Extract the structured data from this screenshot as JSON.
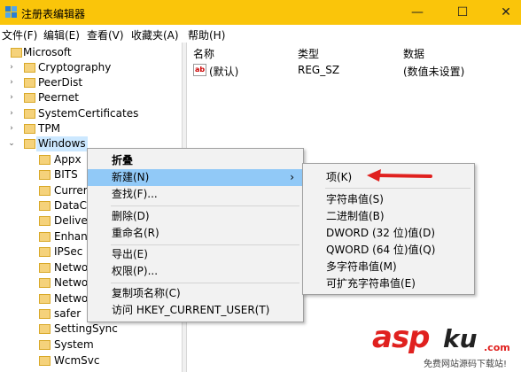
{
  "titlebar": {
    "title": "注册表编辑器",
    "minimize": "—",
    "maximize": "☐",
    "close": "✕"
  },
  "menu": [
    "文件(F)",
    "编辑(E)",
    "查看(V)",
    "收藏夹(A)",
    "帮助(H)"
  ],
  "tree": [
    {
      "label": "Microsoft",
      "arrow": "",
      "selected": false
    },
    {
      "label": "Cryptography",
      "arrow": "›",
      "selected": false
    },
    {
      "label": "PeerDist",
      "arrow": "›",
      "selected": false
    },
    {
      "label": "Peernet",
      "arrow": "›",
      "selected": false
    },
    {
      "label": "SystemCertificates",
      "arrow": "›",
      "selected": false
    },
    {
      "label": "TPM",
      "arrow": "›",
      "selected": false
    },
    {
      "label": "Windows",
      "arrow": "⌄",
      "selected": true
    },
    {
      "label": "Appx",
      "arrow": "",
      "selected": false
    },
    {
      "label": "BITS",
      "arrow": "",
      "selected": false
    },
    {
      "label": "Currer",
      "arrow": "",
      "selected": false
    },
    {
      "label": "DataC",
      "arrow": "",
      "selected": false
    },
    {
      "label": "Delive",
      "arrow": "",
      "selected": false
    },
    {
      "label": "Enhan",
      "arrow": "",
      "selected": false
    },
    {
      "label": "IPSec",
      "arrow": "",
      "selected": false
    },
    {
      "label": "Netwo",
      "arrow": "",
      "selected": false
    },
    {
      "label": "Netwo",
      "arrow": "",
      "selected": false
    },
    {
      "label": "Netwo",
      "arrow": "",
      "selected": false
    },
    {
      "label": "safer",
      "arrow": "",
      "selected": false
    },
    {
      "label": "SettingSync",
      "arrow": "",
      "selected": false
    },
    {
      "label": "System",
      "arrow": "",
      "selected": false
    },
    {
      "label": "WcmSvc",
      "arrow": "",
      "selected": false
    }
  ],
  "list": {
    "headers": {
      "name": "名称",
      "type": "类型",
      "data": "数据"
    },
    "rows": [
      {
        "name": "(默认)",
        "type": "REG_SZ",
        "data": "(数值未设置)",
        "icon": "ab"
      }
    ]
  },
  "context_menu": {
    "items": [
      {
        "label": "折叠",
        "bold": true
      },
      {
        "label": "新建(N)",
        "submenu_arrow": "›",
        "highlighted": true
      },
      {
        "label": "查找(F)..."
      },
      {
        "label": "删除(D)"
      },
      {
        "label": "重命名(R)"
      },
      {
        "label": "导出(E)"
      },
      {
        "label": "权限(P)..."
      },
      {
        "label": "复制项名称(C)"
      },
      {
        "label": "访问 HKEY_CURRENT_USER(T)"
      }
    ]
  },
  "submenu": {
    "items": [
      {
        "label": "项(K)"
      },
      {
        "label": "字符串值(S)"
      },
      {
        "label": "二进制值(B)"
      },
      {
        "label": "DWORD (32 位)值(D)"
      },
      {
        "label": "QWORD (64 位)值(Q)"
      },
      {
        "label": "多字符串值(M)"
      },
      {
        "label": "可扩充字符串值(E)"
      }
    ]
  },
  "watermark": {
    "asp": "asp",
    "ku": "ku",
    "com": ".com",
    "sub": "免费网站源码下载站!"
  },
  "colors": {
    "titlebar": "#fac50a",
    "highlight": "#91c9f7",
    "arrow": "#e0211f",
    "folder": "#f5d27b"
  }
}
